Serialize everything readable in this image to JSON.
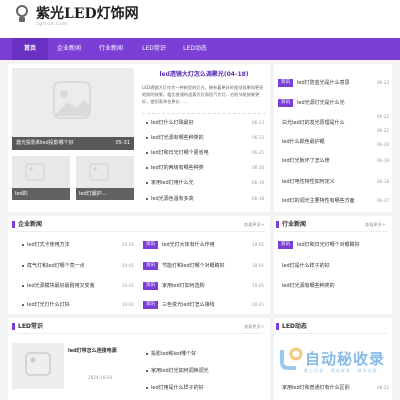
{
  "site": {
    "logo_text": "紫光LED灯饰网",
    "logo_sub": "zgtlcd.com"
  },
  "nav": {
    "items": [
      "首页",
      "企业新闻",
      "行业新闻",
      "LED常识",
      "LED动态"
    ],
    "active_index": 0
  },
  "slider": {
    "caption": "激光投影和led投影哪个好",
    "date": "05-31"
  },
  "thumbs": [
    {
      "caption": "led的"
    },
    {
      "caption": "led灯最护..."
    }
  ],
  "featured": {
    "title": "led透镜大灯怎么调聚光(04-18)",
    "desc": "LED透镜大灯作为一种新型的灯光，拥有着更好的视觉效果和更亮的照明效果。相比普通的卤素大灯和氙气大灯，它的节能效果更好，使用寿命也更长……"
  },
  "mid_news": [
    {
      "title": "led灯什么灯珠最好",
      "date": "06-23"
    },
    {
      "title": "led灯光源有哪些种类的",
      "date": "06-22"
    },
    {
      "title": "led灯和日光灯哪个更省电",
      "date": "06-21"
    },
    {
      "title": "led灯的两级有哪些种类",
      "date": "06-20"
    },
    {
      "title": "家用led灯用什么光",
      "date": "06-19"
    },
    {
      "title": "led光源色温有多高",
      "date": "06-18"
    }
  ],
  "right_top": [
    {
      "tag": "资讯",
      "title": "led灯防蓝光是什么意思",
      "date": "06-23"
    },
    {
      "tag": "资讯",
      "title": "led光源灯光是什么光",
      "date": "06-22"
    },
    {
      "tag": "",
      "title": "白光led灯的发光原理是什么",
      "date": "06-21"
    },
    {
      "tag": "",
      "title": "led什么颜色最护眼",
      "date": "06-20"
    },
    {
      "tag": "",
      "title": "led灯光板坏了怎么修",
      "date": "06-19"
    },
    {
      "tag": "",
      "title": "led灯电性特性如何定义",
      "date": "06-18"
    },
    {
      "tag": "",
      "title": "led灯的调光主要特性有哪些方面",
      "date": "06-17"
    }
  ],
  "sections": {
    "enterprise": {
      "title": "企业新闻",
      "more": "查看更多>"
    },
    "industry": {
      "title": "行业新闻",
      "more": "查看更多>"
    },
    "led_common": {
      "title": "LED常识",
      "more": "查看更多>"
    },
    "led_dynamic": {
      "title": "LED动态"
    }
  },
  "enterprise_left": [
    {
      "title": "led灯式卡使用方法",
      "date": "10-01"
    },
    {
      "title": "氙气灯和led灯哪个亮一点",
      "date": "10-01"
    },
    {
      "title": "led光源模块最好最耐用又安装",
      "date": "10-01"
    },
    {
      "title": "led灯光灯什么灯好",
      "date": "10-01"
    }
  ],
  "enterprise_right": [
    {
      "tag": "资讯",
      "title": "led光灯大体有什么作用",
      "date": "10-01"
    },
    {
      "tag": "资讯",
      "title": "节能灯和led灯哪个对眼睛好",
      "date": "10-01"
    },
    {
      "tag": "资讯",
      "title": "家用led灯如何选购",
      "date": "10-01"
    },
    {
      "tag": "资讯",
      "title": "三色变光led灯怎么接线",
      "date": "10-01"
    }
  ],
  "industry_list": [
    {
      "tag": "资讯",
      "title": "led灯和日光灯哪个对眼睛好"
    },
    {
      "tag": "",
      "title": "led灯是什么样子的好"
    },
    {
      "tag": "",
      "title": "led灯光源有哪些种类的"
    }
  ],
  "led_common": {
    "thumb_title": "led灯带怎么连接电源",
    "thumb_date": "2024-10-03",
    "list": [
      {
        "title": "投影led和led哪个好"
      },
      {
        "title": "家用led灯光如何调换调光"
      },
      {
        "title": "led灯用是什么样子的好"
      }
    ]
  },
  "dynamic_list": [
    {
      "title": "家用led灯和普通灯有什么区别",
      "date": "08-21"
    }
  ],
  "watermark": {
    "text": "自动秘收录",
    "sub": "数上目录 · 网站收录 · 数字站群"
  }
}
